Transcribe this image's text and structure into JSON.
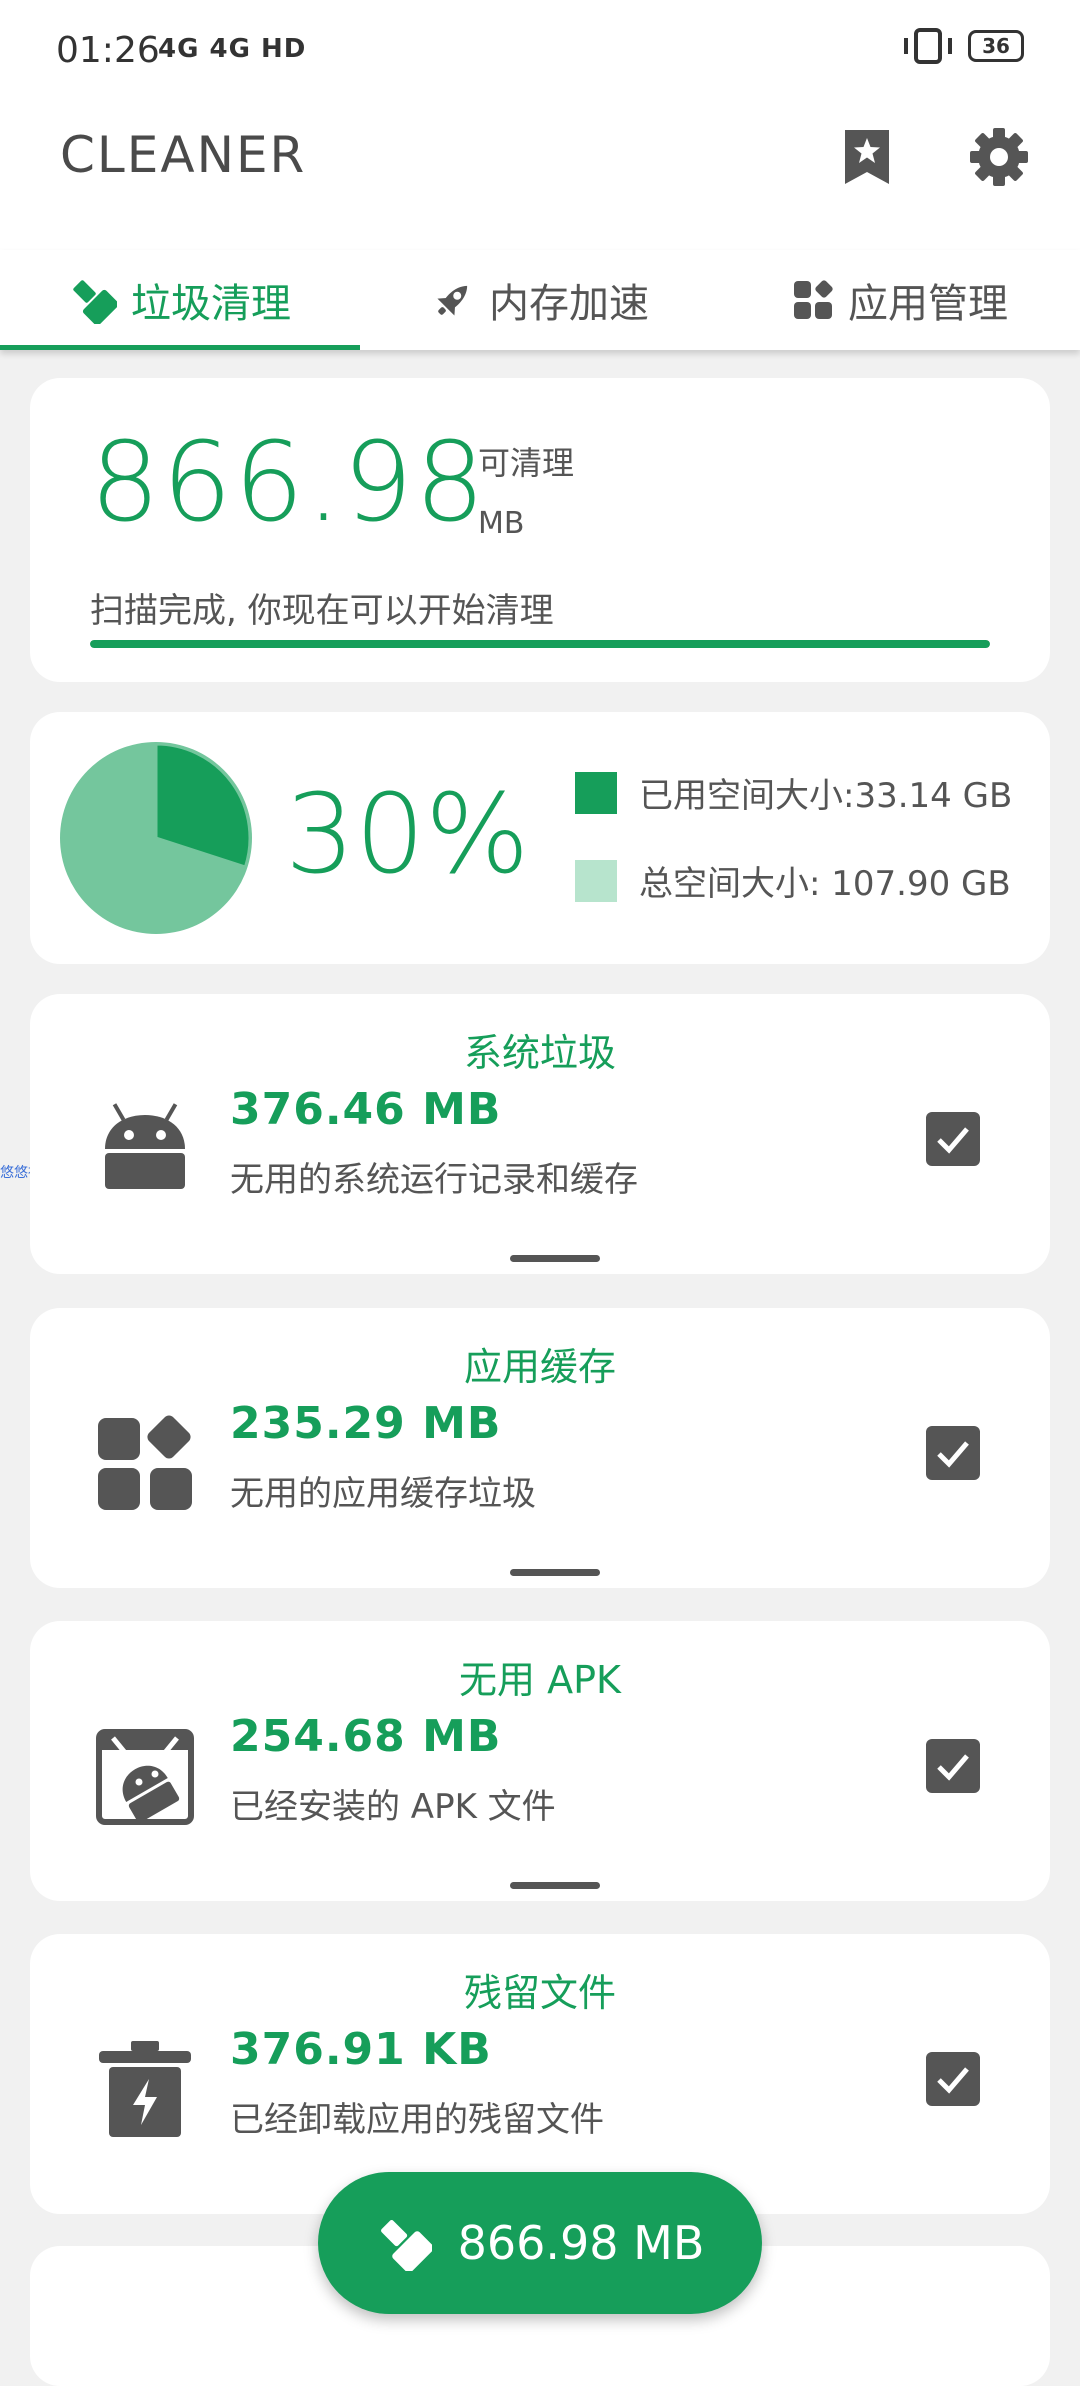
{
  "status_bar": {
    "time": "01:26",
    "signal": "4G 4G HD",
    "battery": "36"
  },
  "app_bar": {
    "title": "CLEANER",
    "bookmark_icon": "bookmark-star-icon",
    "settings_icon": "gear-icon"
  },
  "tabs": [
    {
      "label": "垃圾清理",
      "icon": "broom-icon",
      "active": true
    },
    {
      "label": "内存加速",
      "icon": "rocket-icon",
      "active": false
    },
    {
      "label": "应用管理",
      "icon": "apps-icon",
      "active": false
    }
  ],
  "summary": {
    "amount": "866.98",
    "label": "可清理",
    "unit": "MB",
    "status": "扫描完成, 你现在可以开始清理",
    "progress": 1.0
  },
  "storage": {
    "percent_text": "30%",
    "used_fraction": 0.3,
    "used_label": "已用空间大小:33.14 GB",
    "total_label": "总空间大小: 107.90 GB",
    "used_color": "#169e5a",
    "total_color": "#74c69d"
  },
  "categories": [
    {
      "title": "系统垃圾",
      "size": "376.46 MB",
      "desc": "无用的系统运行记录和缓存",
      "icon": "android-icon",
      "checked": true
    },
    {
      "title": "应用缓存",
      "size": "235.29 MB",
      "desc": "无用的应用缓存垃圾",
      "icon": "app-grid-icon",
      "checked": true
    },
    {
      "title": "无用 APK",
      "size": "254.68 MB",
      "desc": "已经安装的 APK 文件",
      "icon": "apk-icon",
      "checked": true
    },
    {
      "title": "残留文件",
      "size": "376.91 KB",
      "desc": "已经卸载应用的残留文件",
      "icon": "trash-bolt-icon",
      "checked": true
    }
  ],
  "watermark": "悠悠社区",
  "fab": {
    "label": "866.98 MB",
    "icon": "broom-icon"
  },
  "colors": {
    "accent": "#169e5a",
    "background": "#f1f1f1",
    "icon_gray": "#555555"
  }
}
